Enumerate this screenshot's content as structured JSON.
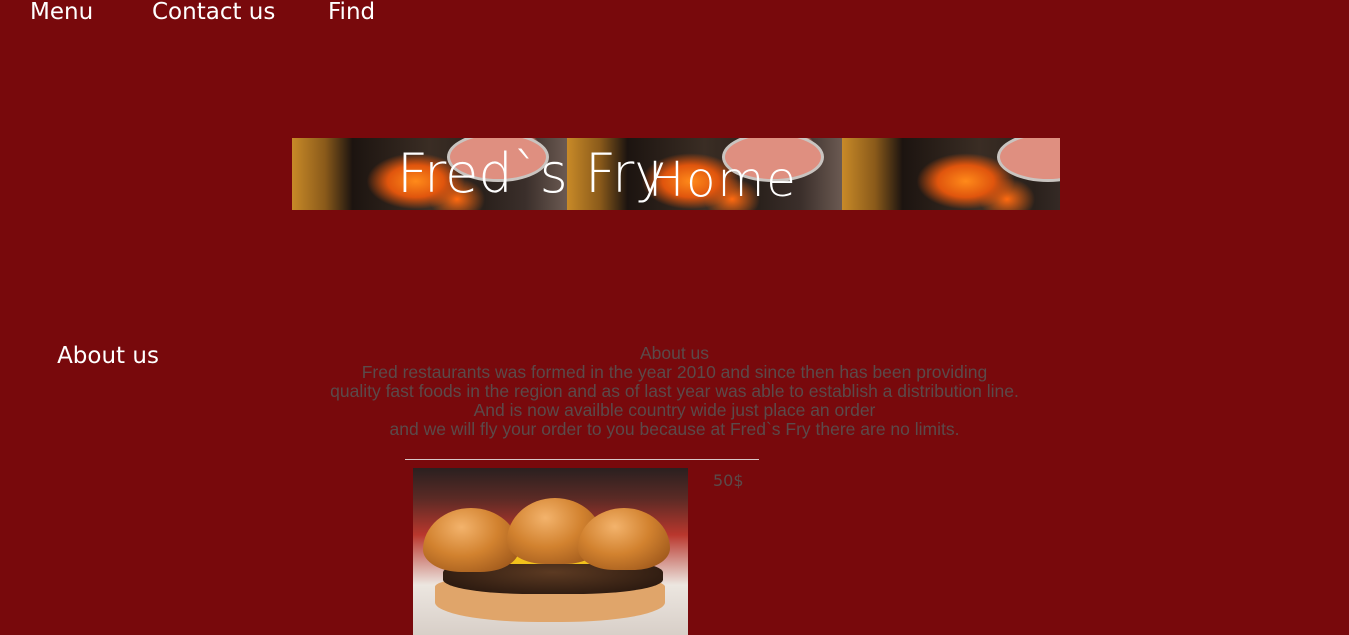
{
  "nav": {
    "items": [
      "About us",
      "Menu",
      "Contact us",
      "Find"
    ]
  },
  "banner": {
    "title": "Fred`s Fry",
    "overlay": "Home"
  },
  "about": {
    "heading": "About us",
    "lines": [
      "Fred restaurants was formed in the year 2010 and since then has been providing",
      "quality fast foods in the region and as of last year was able to establish a distribution line.",
      "And is now availble country wide just place an order",
      "and we will fly your order to you because at Fred`s Fry there are no limits."
    ]
  },
  "product": {
    "price": "50$"
  },
  "colors": {
    "background": "#78090c",
    "text_muted": "#5b4a4a",
    "nav_text": "#ffffff"
  }
}
